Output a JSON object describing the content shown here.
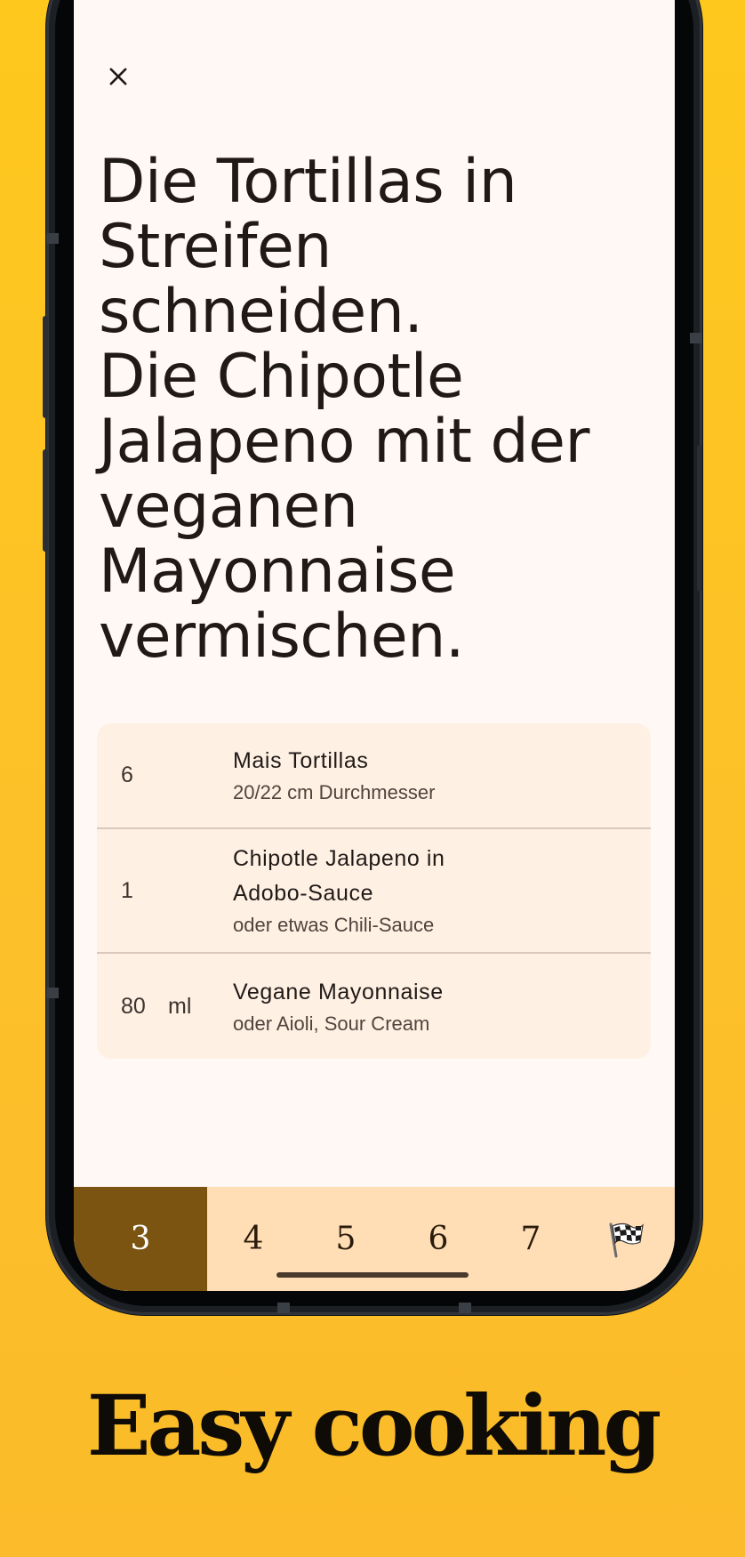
{
  "screen": {
    "close_icon": "close-icon",
    "instruction": "Die Tortillas in\nStreifen\nschneiden.\nDie Chipotle\nJalapeno mit der\nveganen\nMayonnaise\nvermischen."
  },
  "ingredients": [
    {
      "qty": "6",
      "unit": "",
      "name": "Mais Tortillas",
      "note": "20/22 cm Durchmesser"
    },
    {
      "qty": "1",
      "unit": "",
      "name": "Chipotle Jalapeno in Adobo-Sauce",
      "note": "oder etwas Chili-Sauce"
    },
    {
      "qty": "80",
      "unit": "ml",
      "name": "Vegane Mayonnaise",
      "note": "oder Aioli, Sour Cream"
    }
  ],
  "steps": {
    "items": [
      "3",
      "4",
      "5",
      "6",
      "7",
      "🏁"
    ],
    "active_index": 0,
    "finish_icon": "chequered-flag-icon"
  },
  "colors": {
    "background": "#fec81d",
    "screen": "#fff8f5",
    "card": "#fff0e4",
    "stepbar": "#ffddb5",
    "active_step": "#7b5412"
  },
  "tagline": "Easy cooking"
}
